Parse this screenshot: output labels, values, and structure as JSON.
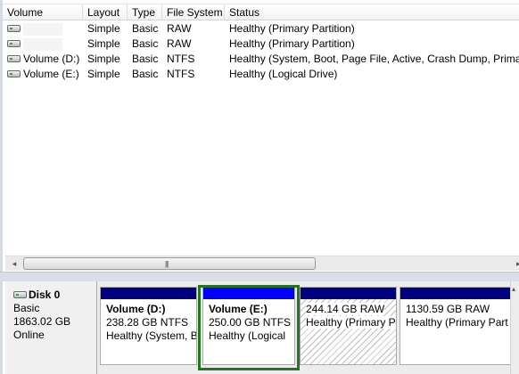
{
  "columns": [
    {
      "key": "volume",
      "label": "Volume"
    },
    {
      "key": "layout",
      "label": "Layout"
    },
    {
      "key": "type",
      "label": "Type"
    },
    {
      "key": "fs",
      "label": "File System"
    },
    {
      "key": "status",
      "label": "Status"
    }
  ],
  "volumes": [
    {
      "volume": "",
      "layout": "Simple",
      "type": "Basic",
      "fs": "RAW",
      "status": "Healthy (Primary Partition)"
    },
    {
      "volume": "",
      "layout": "Simple",
      "type": "Basic",
      "fs": "RAW",
      "status": "Healthy (Primary Partition)"
    },
    {
      "volume": "Volume (D:)",
      "layout": "Simple",
      "type": "Basic",
      "fs": "NTFS",
      "status": "Healthy (System, Boot, Page File, Active, Crash Dump, Primary"
    },
    {
      "volume": "Volume (E:)",
      "layout": "Simple",
      "type": "Basic",
      "fs": "NTFS",
      "status": "Healthy (Logical Drive)"
    }
  ],
  "scrollbar": {
    "grip": "|||",
    "left_arrow": "◂",
    "right_arrow": "▸"
  },
  "disk": {
    "name": "Disk 0",
    "kind": "Basic",
    "size": "1863.02 GB",
    "state": "Online"
  },
  "partitions": [
    {
      "name": "Volume  (D:)",
      "size": "238.28 GB NTFS",
      "status": "Healthy (System, B"
    },
    {
      "name": "Volume  (E:)",
      "size": "250.00 GB NTFS",
      "status": "Healthy (Logical"
    },
    {
      "name": "",
      "size": "244.14 GB RAW",
      "status": "Healthy (Primary P"
    },
    {
      "name": "",
      "size": "1130.59 GB RAW",
      "status": "Healthy (Primary Part"
    }
  ],
  "colors": {
    "primary_bar": "#000080",
    "selected_bar": "#0000ff",
    "selection_frame": "#217621"
  },
  "icons": {
    "volume": "disk-drive-icon",
    "disk": "hard-disk-icon"
  }
}
